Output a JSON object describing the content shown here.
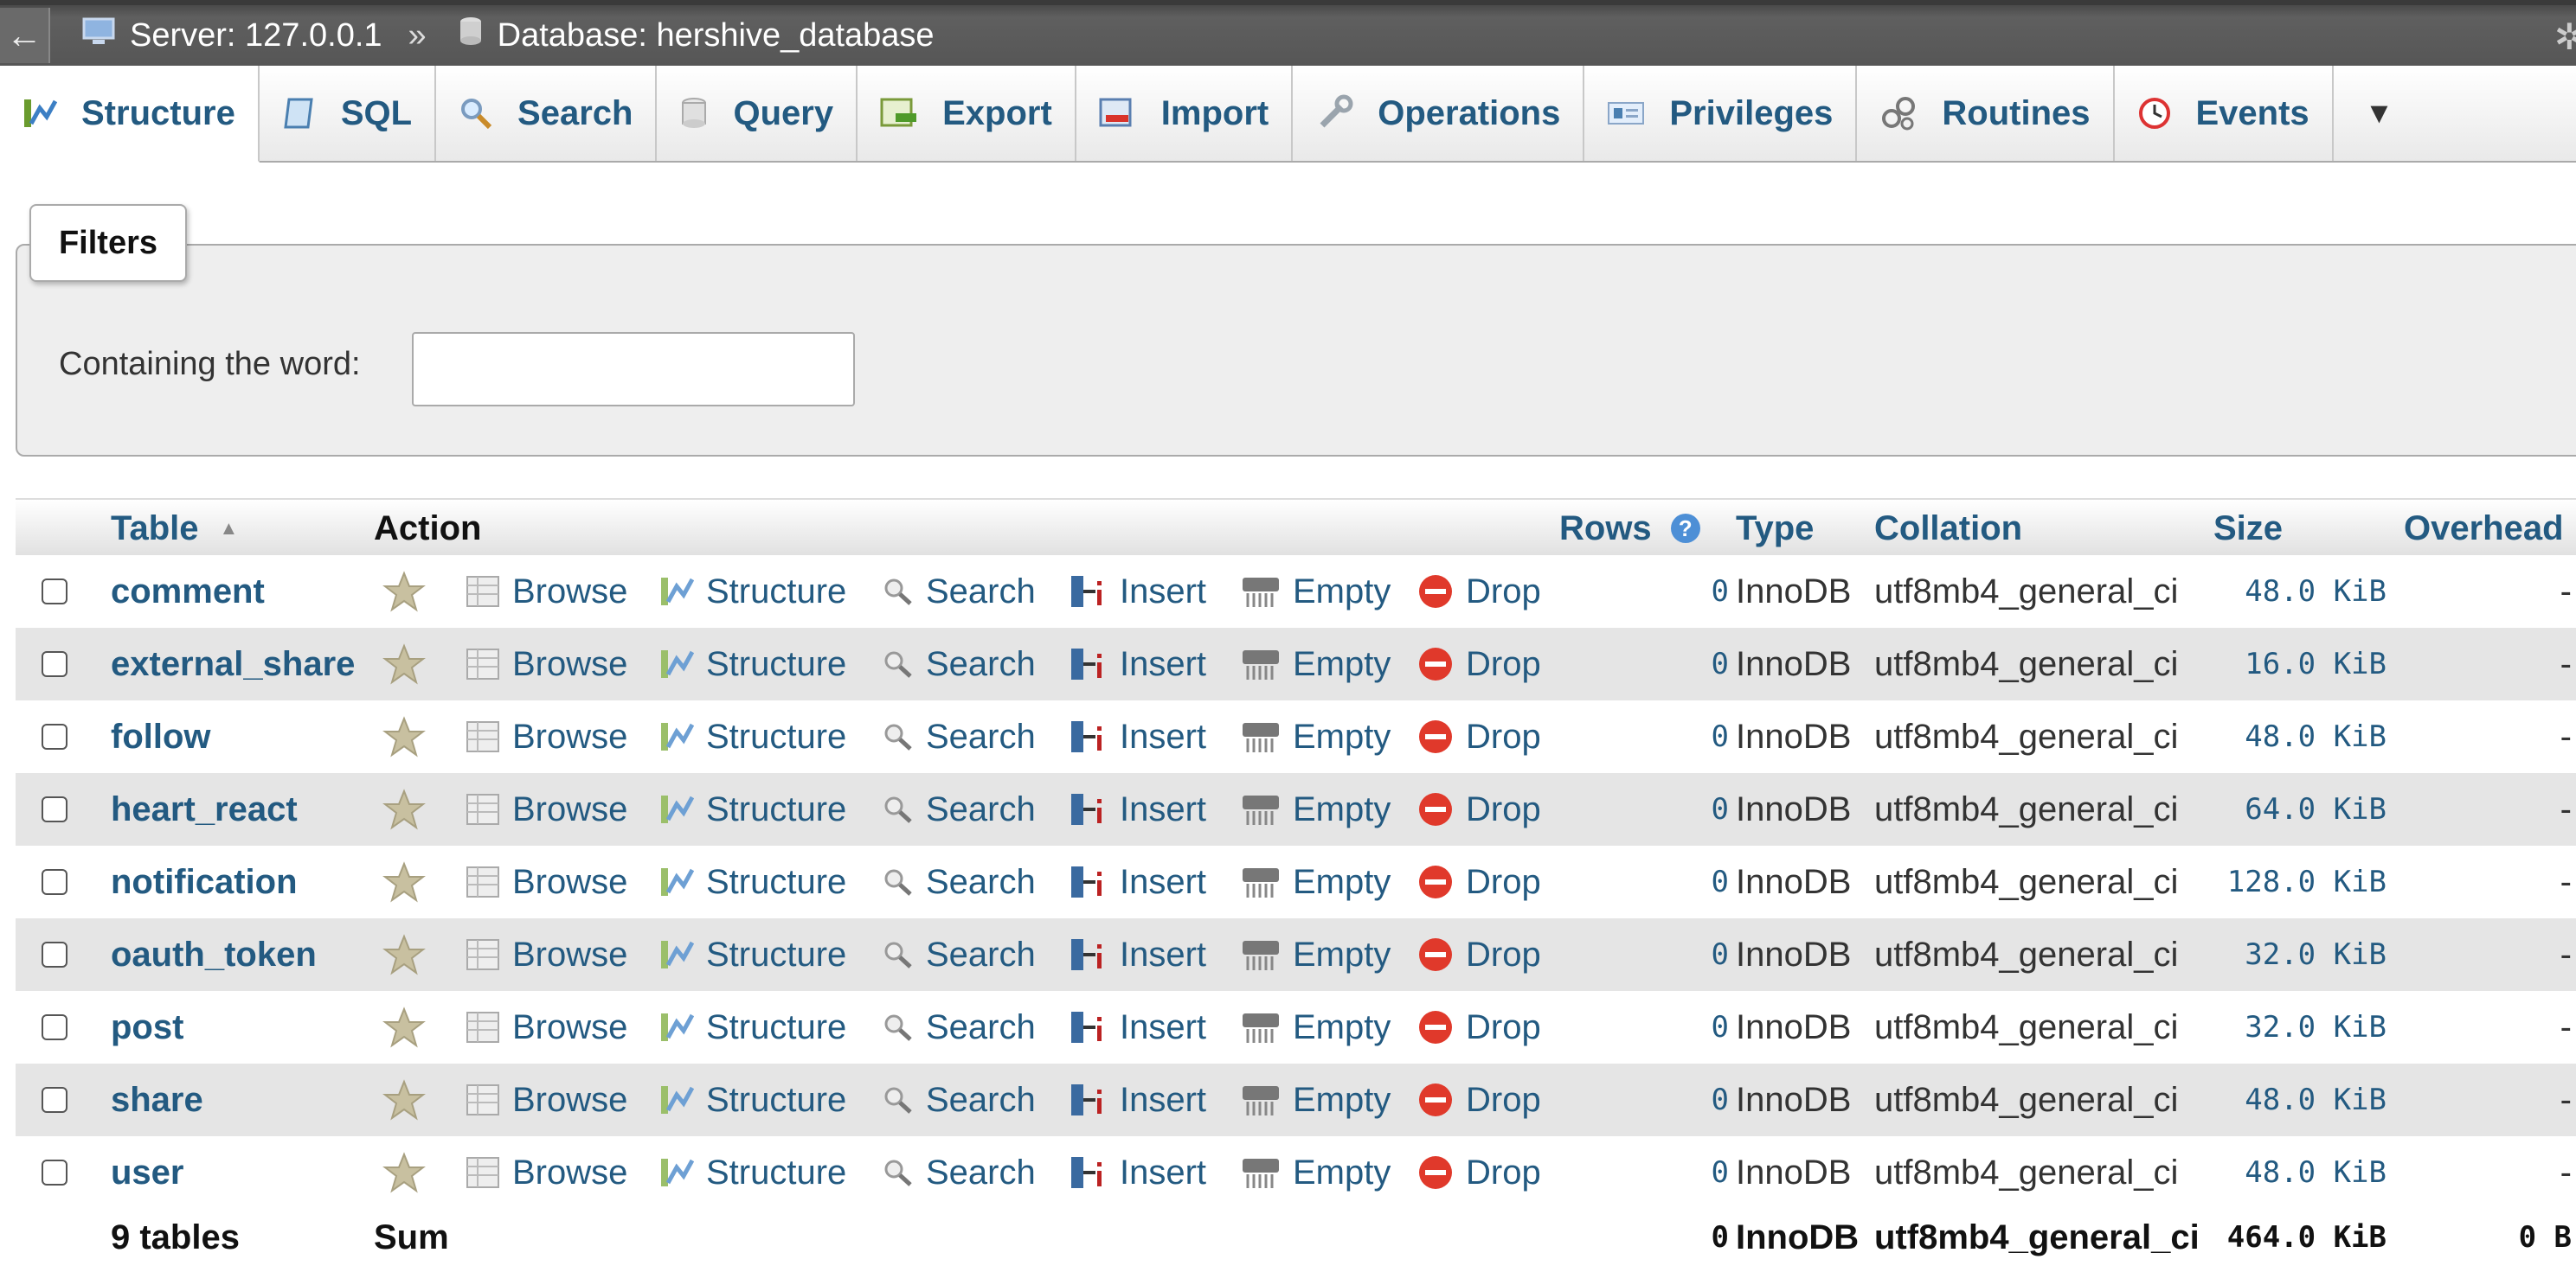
{
  "breadcrumb": {
    "back": "←",
    "server": "Server: 127.0.0.1",
    "separator": "»",
    "database": "Database: hershive_database"
  },
  "tabs": [
    {
      "label": "Structure",
      "icon": "structure-icon"
    },
    {
      "label": "SQL",
      "icon": "sql-icon"
    },
    {
      "label": "Search",
      "icon": "search-icon"
    },
    {
      "label": "Query",
      "icon": "query-icon"
    },
    {
      "label": "Export",
      "icon": "export-icon"
    },
    {
      "label": "Import",
      "icon": "import-icon"
    },
    {
      "label": "Operations",
      "icon": "wrench-icon"
    },
    {
      "label": "Privileges",
      "icon": "privileges-icon"
    },
    {
      "label": "Routines",
      "icon": "routines-icon"
    },
    {
      "label": "Events",
      "icon": "clock-icon"
    }
  ],
  "more_symbol": "▼",
  "filters": {
    "legend": "Filters",
    "label": "Containing the word:",
    "value": ""
  },
  "table": {
    "headers": {
      "table": "Table",
      "action": "Action",
      "rows": "Rows",
      "type": "Type",
      "collation": "Collation",
      "size": "Size",
      "overhead": "Overhead"
    },
    "actions": {
      "browse": "Browse",
      "structure": "Structure",
      "search": "Search",
      "insert": "Insert",
      "empty": "Empty",
      "drop": "Drop"
    },
    "rows": [
      {
        "name": "comment",
        "rows": "0",
        "type": "InnoDB",
        "collation": "utf8mb4_general_ci",
        "size": "48.0 KiB",
        "overhead": "-"
      },
      {
        "name": "external_share",
        "rows": "0",
        "type": "InnoDB",
        "collation": "utf8mb4_general_ci",
        "size": "16.0 KiB",
        "overhead": "-"
      },
      {
        "name": "follow",
        "rows": "0",
        "type": "InnoDB",
        "collation": "utf8mb4_general_ci",
        "size": "48.0 KiB",
        "overhead": "-"
      },
      {
        "name": "heart_react",
        "rows": "0",
        "type": "InnoDB",
        "collation": "utf8mb4_general_ci",
        "size": "64.0 KiB",
        "overhead": "-"
      },
      {
        "name": "notification",
        "rows": "0",
        "type": "InnoDB",
        "collation": "utf8mb4_general_ci",
        "size": "128.0 KiB",
        "overhead": "-"
      },
      {
        "name": "oauth_token",
        "rows": "0",
        "type": "InnoDB",
        "collation": "utf8mb4_general_ci",
        "size": "32.0 KiB",
        "overhead": "-"
      },
      {
        "name": "post",
        "rows": "0",
        "type": "InnoDB",
        "collation": "utf8mb4_general_ci",
        "size": "32.0 KiB",
        "overhead": "-"
      },
      {
        "name": "share",
        "rows": "0",
        "type": "InnoDB",
        "collation": "utf8mb4_general_ci",
        "size": "48.0 KiB",
        "overhead": "-"
      },
      {
        "name": "user",
        "rows": "0",
        "type": "InnoDB",
        "collation": "utf8mb4_general_ci",
        "size": "48.0 KiB",
        "overhead": "-"
      }
    ],
    "footer": {
      "count": "9 tables",
      "sum": "Sum",
      "rows": "0",
      "type": "InnoDB",
      "collation": "utf8mb4_general_ci",
      "size": "464.0 KiB",
      "overhead": "0 B"
    }
  },
  "colors": {
    "link": "#235a81",
    "drop_red": "#e0392b",
    "row_alt": "#e5e5e5",
    "topbar": "#565656"
  }
}
